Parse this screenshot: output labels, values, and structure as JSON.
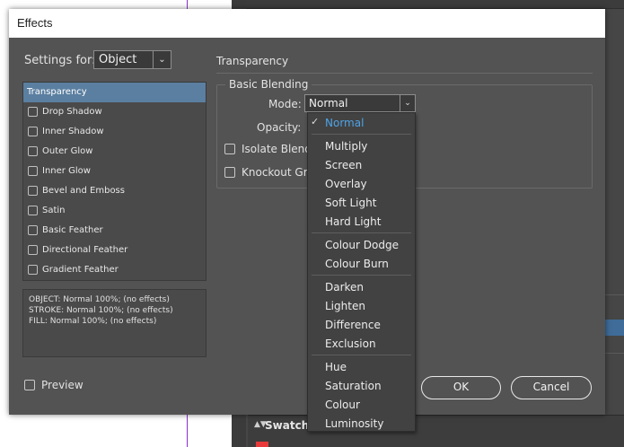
{
  "background": {
    "swatches_panel_label": "Swatches"
  },
  "dialog": {
    "title": "Effects",
    "settings_for_label": "Settings for:",
    "settings_for_value": "Object",
    "effects": [
      {
        "label": "Transparency",
        "selected": true
      },
      {
        "label": "Drop Shadow",
        "checked": false
      },
      {
        "label": "Inner Shadow",
        "checked": false
      },
      {
        "label": "Outer Glow",
        "checked": false
      },
      {
        "label": "Inner Glow",
        "checked": false
      },
      {
        "label": "Bevel and Emboss",
        "checked": false
      },
      {
        "label": "Satin",
        "checked": false
      },
      {
        "label": "Basic Feather",
        "checked": false
      },
      {
        "label": "Directional Feather",
        "checked": false
      },
      {
        "label": "Gradient Feather",
        "checked": false
      }
    ],
    "summary": [
      "OBJECT: Normal 100%; (no effects)",
      "STROKE: Normal 100%; (no effects)",
      "FILL: Normal 100%; (no effects)"
    ],
    "preview_label": "Preview",
    "preview_checked": false,
    "section_title": "Transparency",
    "basic_blending": {
      "group_label": "Basic Blending",
      "mode_label": "Mode:",
      "mode_value": "Normal",
      "opacity_label": "Opacity:",
      "isolate_label": "Isolate Blend",
      "knockout_label": "Knockout Gr"
    },
    "ok_label": "OK",
    "cancel_label": "Cancel"
  },
  "mode_menu": {
    "selected": "Normal",
    "groups": [
      [
        "Normal"
      ],
      [
        "Multiply",
        "Screen",
        "Overlay",
        "Soft Light",
        "Hard Light"
      ],
      [
        "Colour Dodge",
        "Colour Burn"
      ],
      [
        "Darken",
        "Lighten",
        "Difference",
        "Exclusion"
      ],
      [
        "Hue",
        "Saturation",
        "Colour",
        "Luminosity"
      ]
    ]
  },
  "colors": {
    "selection_blue": "#5b7fa0",
    "current_item_blue": "#4ea3e6",
    "guide_purple": "#8a2ec9"
  }
}
